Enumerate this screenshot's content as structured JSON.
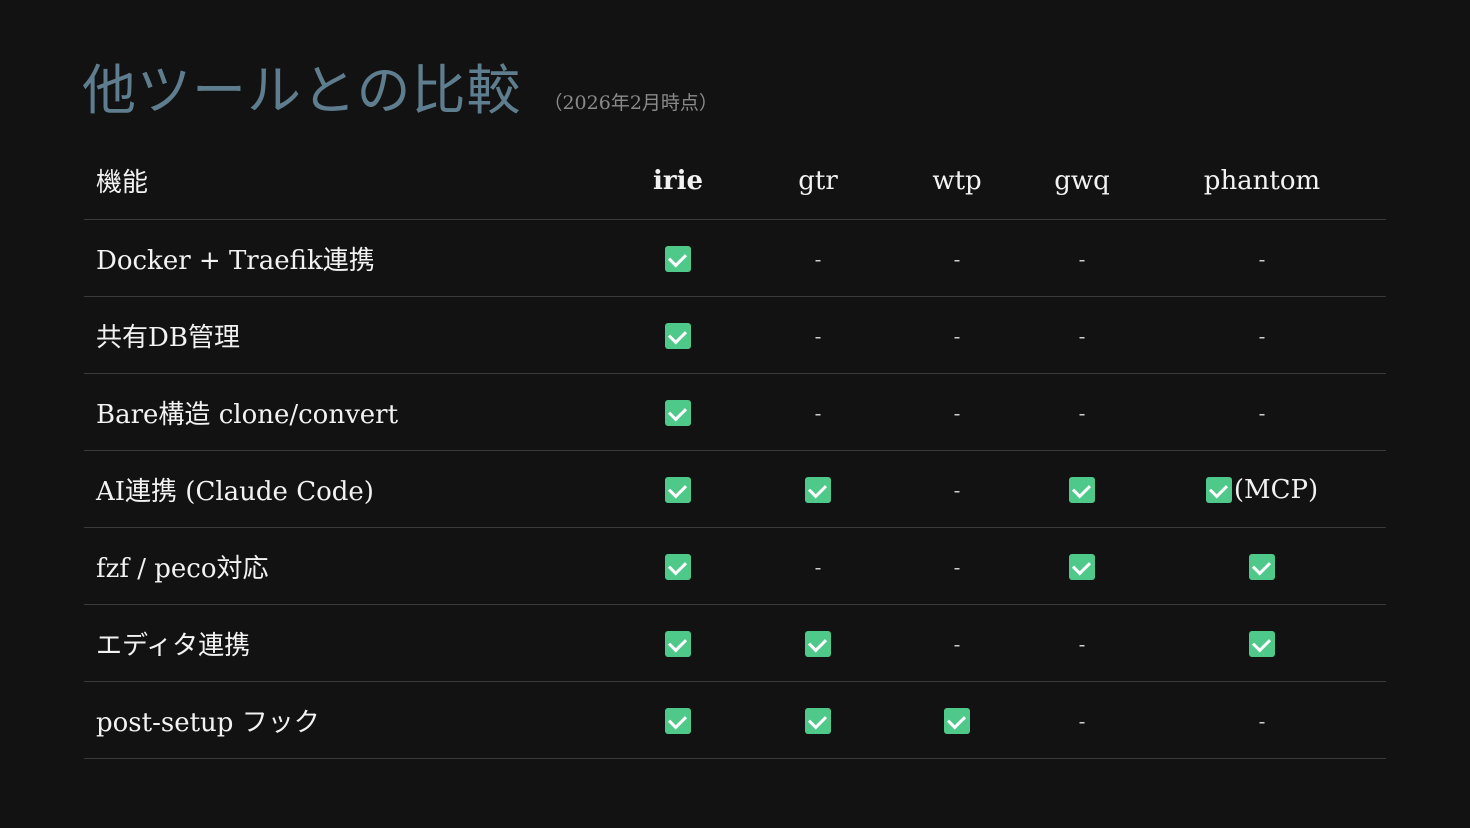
{
  "title": "他ツールとの比較",
  "subtitle": "（2026年2月時点）",
  "table": {
    "feature_header": "機能",
    "tools": [
      "irie",
      "gtr",
      "wtp",
      "gwq",
      "phantom"
    ],
    "highlight_tool": "irie",
    "rows": [
      {
        "feature": "Docker + Traefik連携",
        "cells": [
          {
            "value": "yes",
            "text": ""
          },
          {
            "value": "no",
            "text": "-"
          },
          {
            "value": "no",
            "text": "-"
          },
          {
            "value": "no",
            "text": "-"
          },
          {
            "value": "no",
            "text": "-"
          }
        ]
      },
      {
        "feature": "共有DB管理",
        "cells": [
          {
            "value": "yes",
            "text": ""
          },
          {
            "value": "no",
            "text": "-"
          },
          {
            "value": "no",
            "text": "-"
          },
          {
            "value": "no",
            "text": "-"
          },
          {
            "value": "no",
            "text": "-"
          }
        ]
      },
      {
        "feature": "Bare構造 clone/convert",
        "cells": [
          {
            "value": "yes",
            "text": ""
          },
          {
            "value": "no",
            "text": "-"
          },
          {
            "value": "no",
            "text": "-"
          },
          {
            "value": "no",
            "text": "-"
          },
          {
            "value": "no",
            "text": "-"
          }
        ]
      },
      {
        "feature": "AI連携 (Claude Code)",
        "cells": [
          {
            "value": "yes",
            "text": ""
          },
          {
            "value": "yes",
            "text": ""
          },
          {
            "value": "no",
            "text": "-"
          },
          {
            "value": "yes",
            "text": ""
          },
          {
            "value": "yes",
            "text": "(MCP)"
          }
        ]
      },
      {
        "feature": "fzf / peco対応",
        "cells": [
          {
            "value": "yes",
            "text": ""
          },
          {
            "value": "no",
            "text": "-"
          },
          {
            "value": "no",
            "text": "-"
          },
          {
            "value": "yes",
            "text": ""
          },
          {
            "value": "yes",
            "text": ""
          }
        ]
      },
      {
        "feature": "エディタ連携",
        "cells": [
          {
            "value": "yes",
            "text": ""
          },
          {
            "value": "yes",
            "text": ""
          },
          {
            "value": "no",
            "text": "-"
          },
          {
            "value": "no",
            "text": "-"
          },
          {
            "value": "yes",
            "text": ""
          }
        ]
      },
      {
        "feature": "post-setup フック",
        "cells": [
          {
            "value": "yes",
            "text": ""
          },
          {
            "value": "yes",
            "text": ""
          },
          {
            "value": "yes",
            "text": ""
          },
          {
            "value": "no",
            "text": "-"
          },
          {
            "value": "no",
            "text": "-"
          }
        ]
      }
    ]
  },
  "colors": {
    "background": "#121212",
    "title": "#5e7d8e",
    "check": "#4ec98a",
    "divider": "#3a3a3a"
  },
  "icons": {
    "yes": "check-box-icon"
  }
}
